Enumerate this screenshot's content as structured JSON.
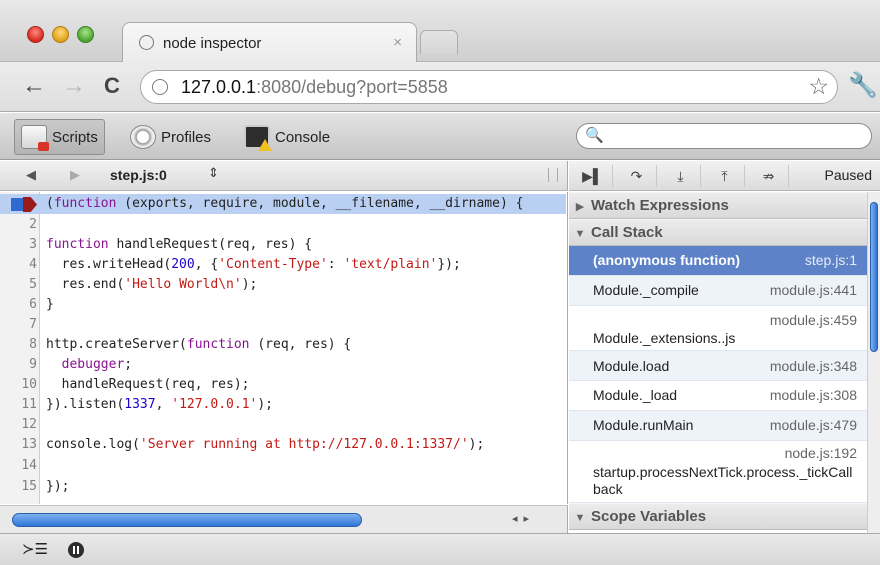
{
  "window": {
    "tab_title": "node inspector",
    "tab_close": "×"
  },
  "toolbar": {
    "back": "←",
    "forward": "→",
    "reload": "C",
    "url_host": "127.0.0.1",
    "url_rest": ":8080/debug?port=5858",
    "star": "☆",
    "wrench": "🔧"
  },
  "devtools_panels": [
    {
      "label": "Scripts",
      "icon": "scripts-icon",
      "active": true
    },
    {
      "label": "Profiles",
      "icon": "profiles-icon",
      "active": false
    },
    {
      "label": "Console",
      "icon": "console-icon",
      "active": false
    }
  ],
  "search_icon": "🔍",
  "source": {
    "nav_back": "◀",
    "nav_forward": "▶",
    "file": "step.js:0",
    "sort": "⇕",
    "current_line": 1,
    "lines": [
      {
        "n": "1",
        "html": "(<span class=\"kw\">function</span> (exports, require, module, __filename, __dirname) {"
      },
      {
        "n": "2",
        "html": ""
      },
      {
        "n": "3",
        "html": "<span class=\"kw\">function</span> handleRequest(req, res) {"
      },
      {
        "n": "4",
        "html": "  res.writeHead(<span class=\"num\">200</span>, {<span class=\"str\">'Content-Type'</span>: <span class=\"str\">'text/plain'</span>});"
      },
      {
        "n": "5",
        "html": "  res.end(<span class=\"str\">'Hello World\\n'</span>);"
      },
      {
        "n": "6",
        "html": "}"
      },
      {
        "n": "7",
        "html": ""
      },
      {
        "n": "8",
        "html": "http.createServer(<span class=\"kw\">function</span> (req, res) {"
      },
      {
        "n": "9",
        "html": "  <span class=\"kw\">debugger</span>;"
      },
      {
        "n": "10",
        "html": "  handleRequest(req, res);"
      },
      {
        "n": "11",
        "html": "}).listen(<span class=\"num\">1337</span>, <span class=\"str\">'127.0.0.1'</span>);"
      },
      {
        "n": "12",
        "html": ""
      },
      {
        "n": "13",
        "html": "console.log(<span class=\"str\">'Server running at http://127.0.0.1:1337/'</span>);"
      },
      {
        "n": "14",
        "html": ""
      },
      {
        "n": "15",
        "html": "});"
      }
    ]
  },
  "debugger_controls": [
    {
      "name": "resume-button",
      "glyph": "▶▌"
    },
    {
      "name": "step-over-button",
      "glyph": "↷"
    },
    {
      "name": "step-into-button",
      "glyph": "⤓"
    },
    {
      "name": "step-out-button",
      "glyph": "⤒"
    },
    {
      "name": "deactivate-breakpoints-button",
      "glyph": "⇏"
    }
  ],
  "status": "Paused",
  "sidebar": {
    "watch_title": "Watch Expressions",
    "call_stack_title": "Call Stack",
    "scope_title": "Scope Variables",
    "frames": [
      {
        "fn": "(anonymous function)",
        "loc": "step.js:1",
        "selected": true
      },
      {
        "fn": "Module._compile",
        "loc": "module.js:441"
      },
      {
        "fn": "Module._extensions..js",
        "loc": "module.js:459"
      },
      {
        "fn": "Module.load",
        "loc": "module.js:348"
      },
      {
        "fn": "Module._load",
        "loc": "module.js:308"
      },
      {
        "fn": "Module.runMain",
        "loc": "module.js:479"
      },
      {
        "fn": "startup.processNextTick.process._tickCallback",
        "loc": "node.js:192"
      }
    ]
  },
  "statusbar": {
    "console_toggle": "≻☰"
  }
}
